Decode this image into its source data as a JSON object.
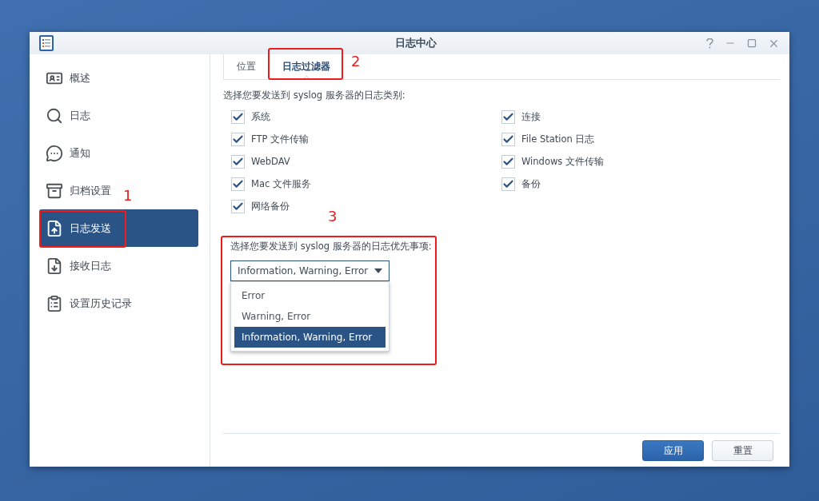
{
  "window": {
    "title": "日志中心"
  },
  "sidebar": {
    "items": [
      {
        "label": "概述",
        "selected": false
      },
      {
        "label": "日志",
        "selected": false
      },
      {
        "label": "通知",
        "selected": false
      },
      {
        "label": "归档设置",
        "selected": false
      },
      {
        "label": "日志发送",
        "selected": true
      },
      {
        "label": "接收日志",
        "selected": false
      },
      {
        "label": "设置历史记录",
        "selected": false
      }
    ]
  },
  "tabs": [
    {
      "label": "位置",
      "selected": false
    },
    {
      "label": "日志过滤器",
      "selected": true
    }
  ],
  "categories_label": "选择您要发送到 syslog 服务器的日志类别:",
  "categories": [
    {
      "label": "系统",
      "checked": true
    },
    {
      "label": "连接",
      "checked": true
    },
    {
      "label": "FTP 文件传输",
      "checked": true
    },
    {
      "label": "File Station 日志",
      "checked": true
    },
    {
      "label": "WebDAV",
      "checked": true
    },
    {
      "label": "Windows 文件传输",
      "checked": true
    },
    {
      "label": "Mac 文件服务",
      "checked": true
    },
    {
      "label": "备份",
      "checked": true
    },
    {
      "label": "网络备份",
      "checked": true
    }
  ],
  "priority": {
    "label": "选择您要发送到 syslog 服务器的日志优先事项:",
    "value": "Information, Warning, Error",
    "options": [
      {
        "label": "Error",
        "selected": false
      },
      {
        "label": "Warning, Error",
        "selected": false
      },
      {
        "label": "Information, Warning, Error",
        "selected": true
      }
    ]
  },
  "buttons": [
    {
      "label": "应用",
      "kind": "primary"
    },
    {
      "label": "重置",
      "kind": "secondary"
    }
  ],
  "annotations": [
    {
      "label": "1"
    },
    {
      "label": "2"
    },
    {
      "label": "3"
    }
  ]
}
